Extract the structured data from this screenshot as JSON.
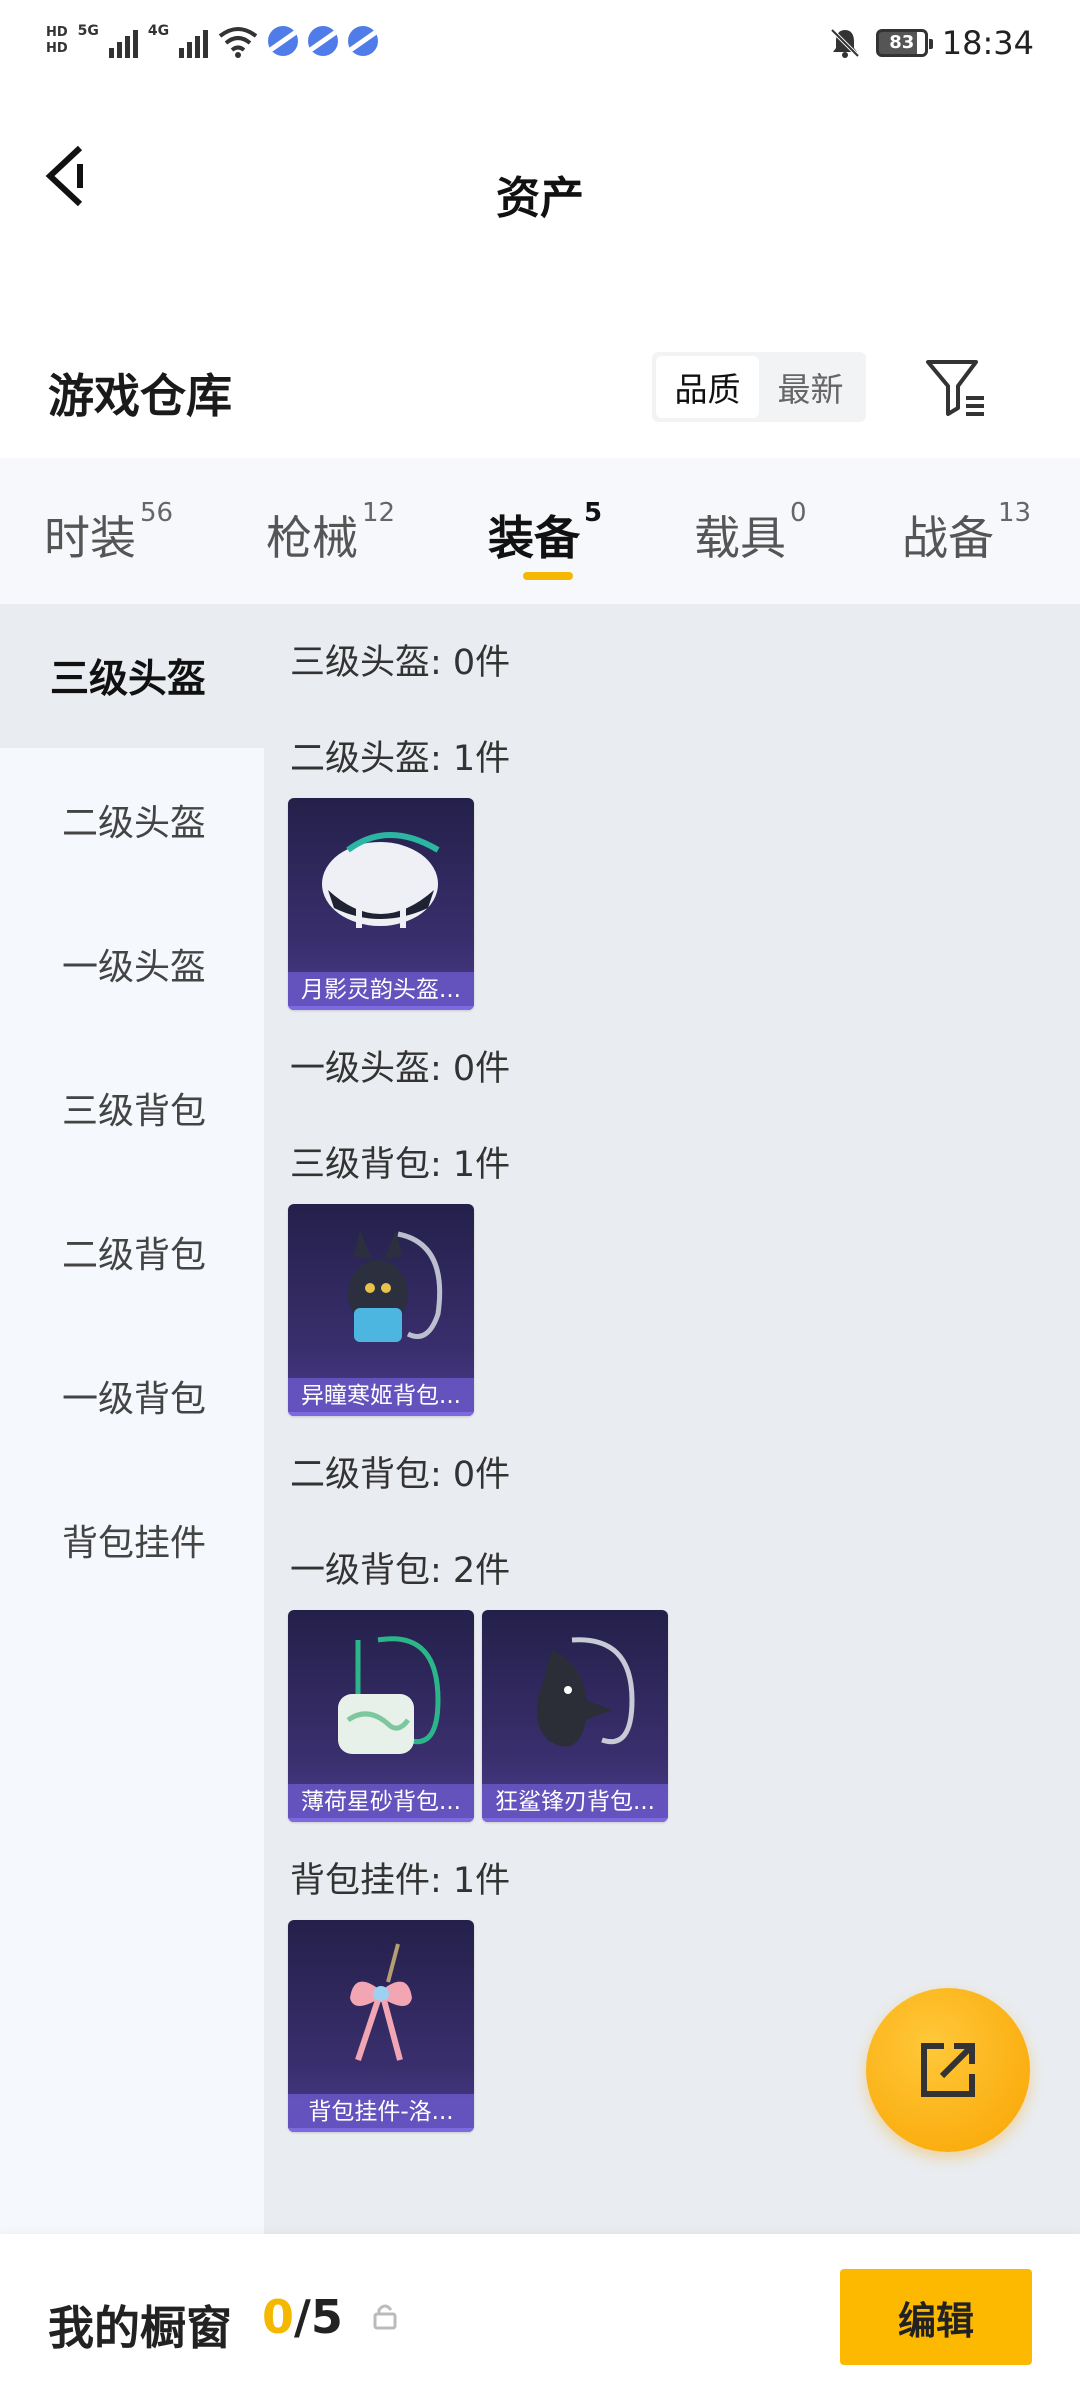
{
  "status_bar": {
    "hd_top": "HD",
    "hd_bottom": "HD",
    "net_a": "5G",
    "net_b": "4G",
    "battery": "83",
    "time": "18:34"
  },
  "header": {
    "title": "资产"
  },
  "warehouse": {
    "title": "游戏仓库",
    "sort_quality": "品质",
    "sort_latest": "最新"
  },
  "tabs": [
    {
      "label": "时装",
      "count": "56"
    },
    {
      "label": "枪械",
      "count": "12"
    },
    {
      "label": "装备",
      "count": "5"
    },
    {
      "label": "载具",
      "count": "0"
    },
    {
      "label": "战备",
      "count": "13"
    }
  ],
  "sidebar": [
    {
      "label": "三级头盔"
    },
    {
      "label": "二级头盔"
    },
    {
      "label": "一级头盔"
    },
    {
      "label": "三级背包"
    },
    {
      "label": "二级背包"
    },
    {
      "label": "一级背包"
    },
    {
      "label": "背包挂件"
    }
  ],
  "sections": [
    {
      "title": "三级头盔: 0件"
    },
    {
      "title": "二级头盔: 1件",
      "items": [
        "月影灵韵头盔..."
      ]
    },
    {
      "title": "一级头盔: 0件"
    },
    {
      "title": "三级背包: 1件",
      "items": [
        "异瞳寒姬背包..."
      ]
    },
    {
      "title": "二级背包: 0件"
    },
    {
      "title": "一级背包: 2件",
      "items": [
        "薄荷星砂背包...",
        "狂鲨锋刃背包..."
      ]
    },
    {
      "title": "背包挂件: 1件",
      "items": [
        "背包挂件-洛..."
      ]
    }
  ],
  "bottom": {
    "title": "我的橱窗",
    "current": "0",
    "separator": "/",
    "max": "5",
    "edit_label": "编辑"
  },
  "colors": {
    "accent": "#fdb800",
    "card_bg": "#3a2f6e",
    "card_caption": "#6a57c8"
  }
}
